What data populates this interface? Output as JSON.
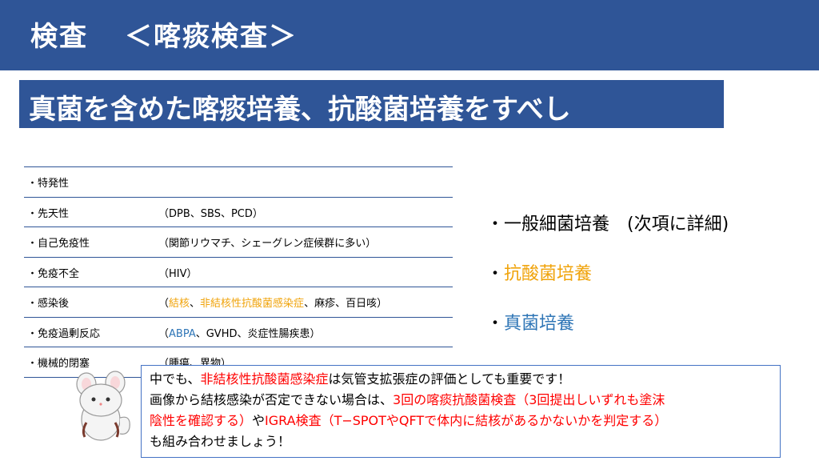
{
  "header": {
    "title": "検査",
    "subtitle": "＜喀痰検査＞"
  },
  "banner": {
    "text": "真菌を含めた喀痰培養、抗酸菌培養をすべし"
  },
  "table": {
    "rows": [
      {
        "label": "・特発性",
        "parts": []
      },
      {
        "label": "・先天性",
        "parts": [
          {
            "text": "（DPB、SBS、PCD）",
            "color": ""
          }
        ]
      },
      {
        "label": "・自己免疫性",
        "parts": [
          {
            "text": "（関節リウマチ、シェーグレン症候群に多い）",
            "color": ""
          }
        ]
      },
      {
        "label": "・免疫不全",
        "parts": [
          {
            "text": "（HIV）",
            "color": ""
          }
        ]
      },
      {
        "label": "・感染後",
        "parts": [
          {
            "text": "（",
            "color": ""
          },
          {
            "text": "結核",
            "color": "orange"
          },
          {
            "text": "、",
            "color": ""
          },
          {
            "text": "非結核性抗酸菌感染症",
            "color": "orange"
          },
          {
            "text": "、麻疹、百日咳）",
            "color": ""
          }
        ]
      },
      {
        "label": "・免疫過剰反応",
        "parts": [
          {
            "text": "（",
            "color": ""
          },
          {
            "text": "ABPA",
            "color": "blue"
          },
          {
            "text": "、GVHD、炎症性腸疾患）",
            "color": ""
          }
        ]
      },
      {
        "label": "・機械的閉塞",
        "parts": [
          {
            "text": "（腫瘍、異物）",
            "color": ""
          }
        ]
      }
    ]
  },
  "right_list": [
    {
      "text": "・一般細菌培養　(次項に詳細)",
      "color": ""
    },
    {
      "text": "・抗酸菌培養",
      "color": "orange",
      "bullet": "・",
      "label": "抗酸菌培養"
    },
    {
      "text": "・真菌培養",
      "color": "blue",
      "bullet": "・",
      "label": "真菌培養"
    }
  ],
  "right": {
    "item1": "・一般細菌培養　(次項に詳細)",
    "bullet": "・",
    "item2": "抗酸菌培養",
    "item3": "真菌培養"
  },
  "note": {
    "line1_a": "中でも、",
    "line1_b": "非結核性抗酸菌感染症",
    "line1_c": "は気管支拡張症の評価としても重要です！",
    "line2_a": "画像から結核感染が否定できない場合は、",
    "line2_b": "3回の喀痰抗酸菌検査（3回提出しいずれも塗沫",
    "line3_a": "陰性を確認する）",
    "line3_b": "や",
    "line3_c": "IGRA検査（T−SPOTやQFTで体内に結核があるかないかを判定する）",
    "line4": "も組み合わせましょう！"
  },
  "colors": {
    "primary": "#2f5597",
    "orange": "#f0a30a",
    "blue": "#2e75b6",
    "red": "#ff0000"
  },
  "mascot": {
    "icon": "chinchilla-mascot-icon"
  }
}
